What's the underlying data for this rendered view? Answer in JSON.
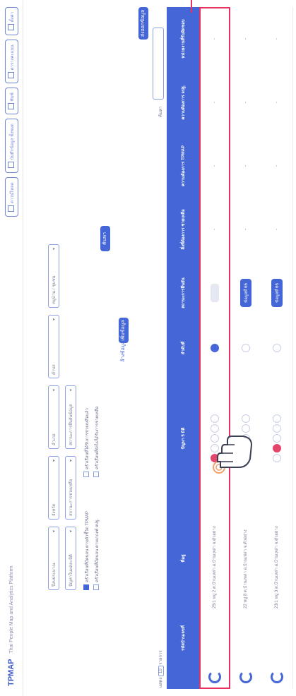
{
  "header": {
    "logo": "TPMAP",
    "subtitle": "Thai People Map and Analytics Platform",
    "buttons": [
      "ดาวน์โหลด",
      "บันทึกข้อมูล ทั้งหมด",
      "พิมพ์",
      "ตารางคะแนน",
      "ตั้งค่า"
    ]
  },
  "filters": {
    "fields": [
      "ปีงบประมาณ",
      "จังหวัด",
      "อำเภอ",
      "ตำบล",
      "หมู่บ้าน / ชุมชน",
      "ปัญหาในแต่ละมิติ",
      "สถานะการช่วยเหลือ",
      "สถานะการยืนยันข้อมูล"
    ],
    "checkboxes": [
      "ครัวเรือนที่มีคนจน ตามตัวชี้วัด TPMAP",
      "ครัวเรือนที่มีคนจน ตามเกณฑ์ จปฐ.",
      "ครัวเรือนที่ได้รับการช่วยเหลือแล้ว",
      "ครัวเรือนที่ยังไม่ได้รับการช่วยเหลือ"
    ],
    "search_button": "ค้นหา",
    "clear_button": "ล้างข้อมูล",
    "add_button": "เพิ่มข้อมูล"
  },
  "table": {
    "show_label": "แสดง",
    "page_size": "10",
    "show_suffix": "รายการ",
    "search_label": "ค้นหา",
    "export_button": "ส่งออกข้อมูล",
    "columns": [
      "",
      "รหัสบ้านเลขที่",
      "ที่อยู่",
      "",
      "ปัญหา 5 มิติ",
      "",
      "ลำดับที่",
      "สถานะการยืนยัน",
      "สิ่งที่ต้องการ ช่วยเหลือ",
      "ความต้องการ TPMAP",
      "ความต้องการ จปฐ.",
      "หน่วยงานที่รับผิดชอบ"
    ],
    "rows": [
      {
        "address": "25/1 หมู่ 2 ต.บ้านเหล่า อ.บ้านเหล่า จ.ตัวอย่าง",
        "action": "",
        "dash": "-"
      },
      {
        "address": "22 หมู่ 8 ต.บ้านเหล่า อ.บ้านเหล่า จ.ตัวอย่าง",
        "action": "ข้อมูลที่ 65",
        "dash": "-"
      },
      {
        "address": "23/1 หมู่ 3 ต.บ้านเหล่า อ.บ้านเหล่า จ.ตัวอย่าง",
        "action": "ข้อมูลที่ 65",
        "dash": "-"
      }
    ]
  },
  "colors": {
    "primary": "#4566d6",
    "highlight": "#e8315f"
  }
}
